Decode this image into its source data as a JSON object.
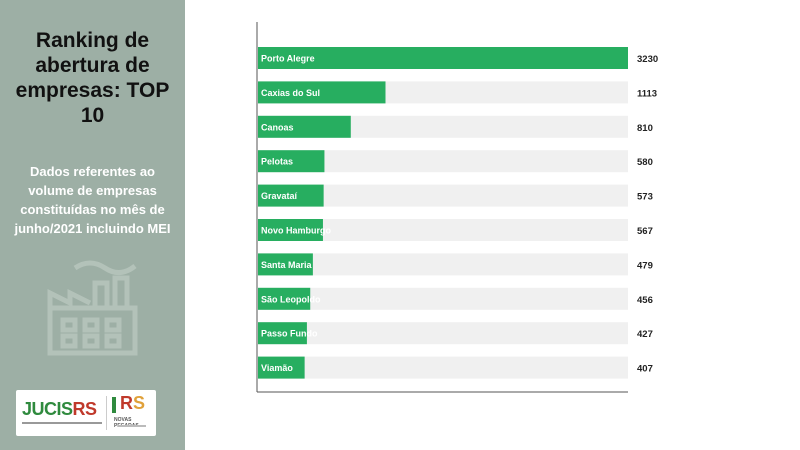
{
  "sidebar": {
    "title": "Ranking de abertura de empresas: TOP 10",
    "subtitle": "Dados referentes ao volume de empresas constituídas no mês de junho/2021 incluindo MEI",
    "icon": "factory-icon",
    "logos": {
      "jucis": "JUCISRS",
      "rs": "RS",
      "rs_caption": "NOVAS PEGADAS"
    }
  },
  "colors": {
    "bar": "#27ae60",
    "track": "#f0f0f0",
    "sidebar": "#9dafa5"
  },
  "chart_data": {
    "type": "bar",
    "orientation": "horizontal",
    "categories": [
      "Porto Alegre",
      "Caxias do Sul",
      "Canoas",
      "Pelotas",
      "Gravataí",
      "Novo Hamburgo",
      "Santa Maria",
      "São Leopoldo",
      "Passo Fundo",
      "Viamão"
    ],
    "values": [
      3230,
      1113,
      810,
      580,
      573,
      567,
      479,
      456,
      427,
      407
    ],
    "xlim": [
      0,
      3230
    ],
    "grid": false,
    "value_labels": true
  }
}
